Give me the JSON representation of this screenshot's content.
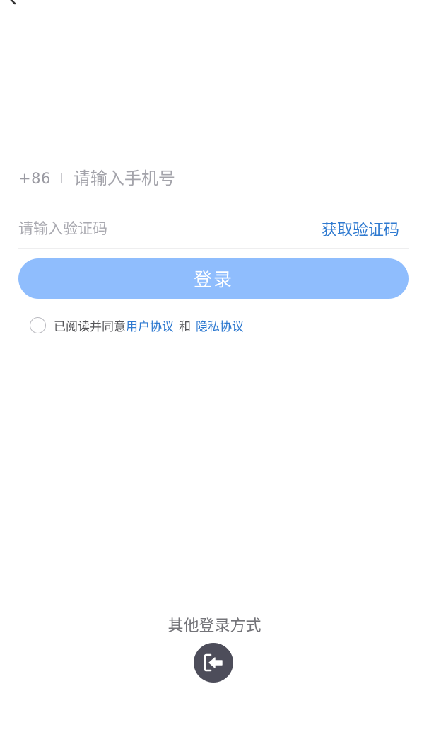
{
  "header": {
    "back_icon": "chevron-left-icon"
  },
  "phone": {
    "country_code": "+86",
    "placeholder": "请输入手机号"
  },
  "code": {
    "placeholder": "请输入验证码",
    "get_code_label": "获取验证码"
  },
  "login": {
    "label": "登录"
  },
  "agreement": {
    "prefix": "已阅读并同意",
    "user_agreement": "用户协议",
    "and": "和",
    "privacy_agreement": "隐私协议"
  },
  "other": {
    "label": "其他登录方式",
    "icon": "sign-in-arrow-icon"
  },
  "colors": {
    "accent": "#2f7ad0",
    "login_button": "#8fbdfd",
    "alt_login_circle": "#4d4d5a"
  }
}
